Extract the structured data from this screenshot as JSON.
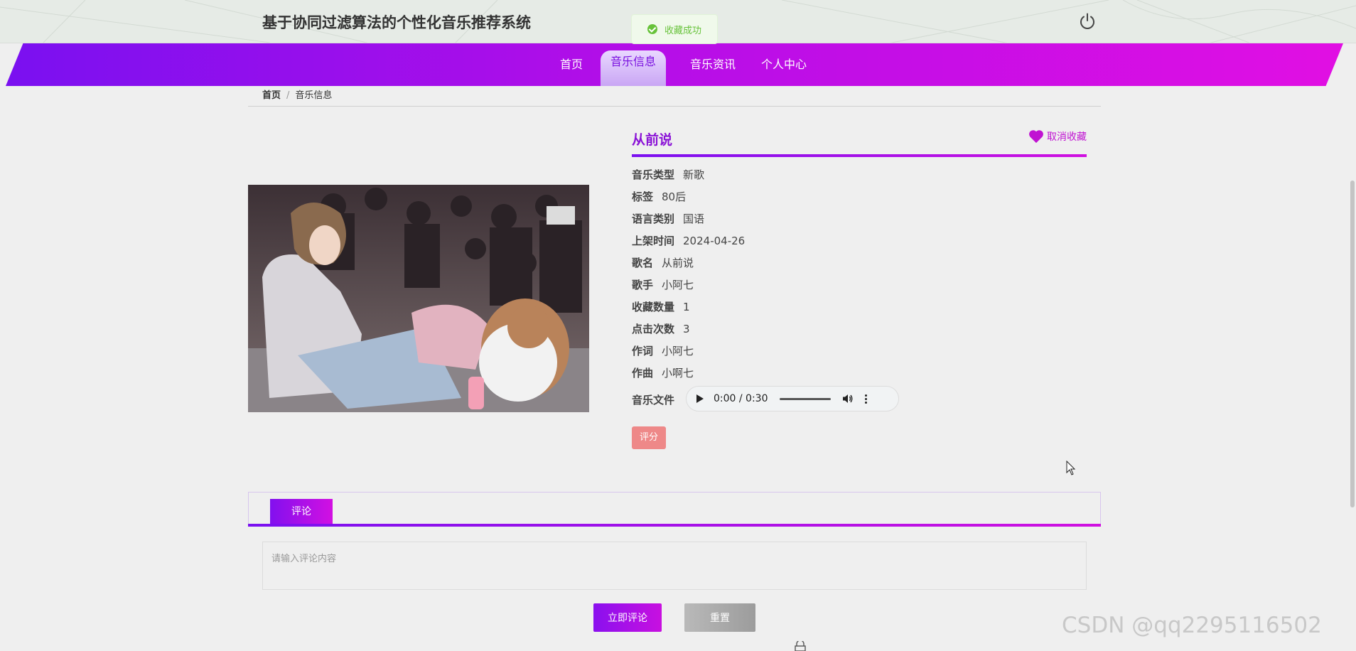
{
  "header": {
    "site_title": "基于协同过滤算法的个性化音乐推荐系统",
    "logout_icon": "power-icon"
  },
  "toast": {
    "message": "收藏成功",
    "icon": "check-circle-icon",
    "color": "#67c23a"
  },
  "nav": {
    "items": [
      {
        "label": "首页",
        "active": false
      },
      {
        "label": "音乐信息",
        "active": true
      },
      {
        "label": "音乐资讯",
        "active": false
      },
      {
        "label": "个人中心",
        "active": false
      }
    ]
  },
  "breadcrumb": {
    "home": "首页",
    "current": "音乐信息",
    "separator": "/"
  },
  "detail": {
    "title": "从前说",
    "fav_label": "取消收藏",
    "fav_icon": "heart-icon",
    "rows": [
      {
        "key": "音乐类型",
        "value": "新歌"
      },
      {
        "key": "标签",
        "value": "80后"
      },
      {
        "key": "语言类别",
        "value": "国语"
      },
      {
        "key": "上架时间",
        "value": "2024-04-26"
      },
      {
        "key": "歌名",
        "value": "从前说"
      },
      {
        "key": "歌手",
        "value": "小阿七"
      },
      {
        "key": "收藏数量",
        "value": "1"
      },
      {
        "key": "点击次数",
        "value": "3"
      },
      {
        "key": "作词",
        "value": "小阿七"
      },
      {
        "key": "作曲",
        "value": "小啊七"
      }
    ],
    "audio_label": "音乐文件",
    "audio_time": "0:00 / 0:30",
    "rate_label": "评分"
  },
  "comment": {
    "tab_label": "评论",
    "placeholder": "请输入评论内容",
    "submit_label": "立即评论",
    "reset_label": "重置"
  },
  "watermark": "CSDN @qq2295116502",
  "colors": {
    "accent": "#8a12d6",
    "nav_gradient_start": "#7a10f0",
    "nav_gradient_end": "#e10fe3",
    "rate_button": "#ee8888"
  }
}
